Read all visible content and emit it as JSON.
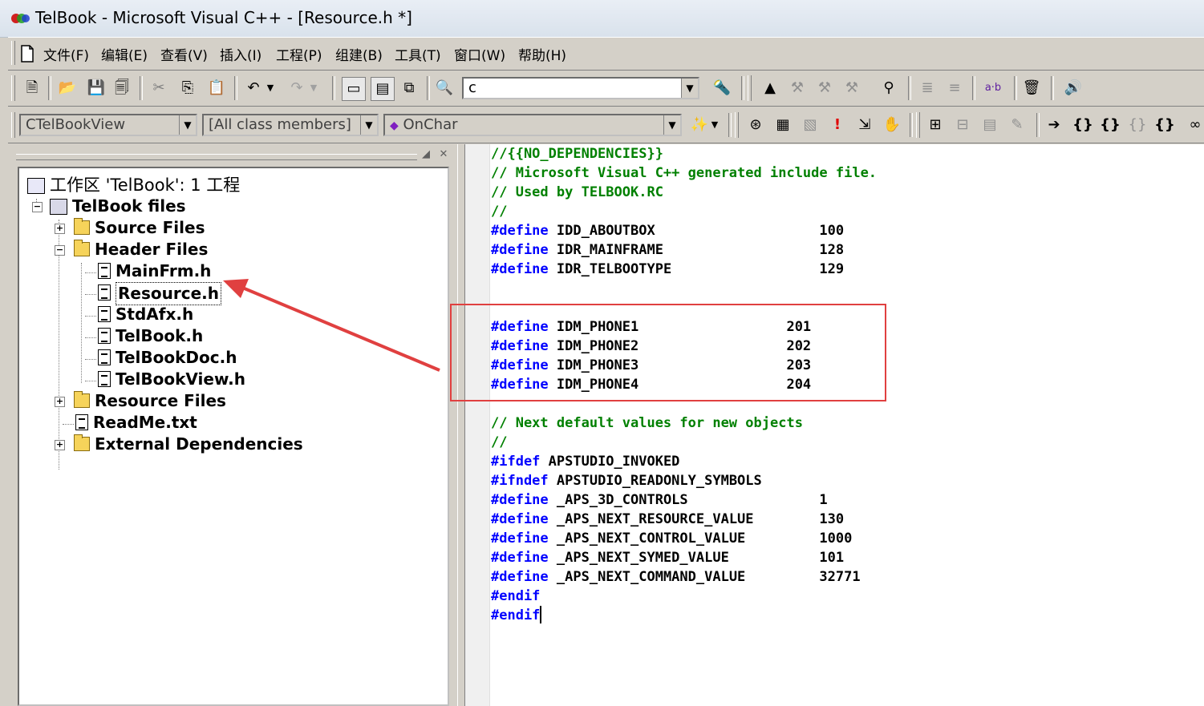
{
  "window": {
    "title": "TelBook - Microsoft Visual C++ - [Resource.h *]"
  },
  "menu": [
    "文件(F)",
    "编辑(E)",
    "查看(V)",
    "插入(I)",
    "工程(P)",
    "组建(B)",
    "工具(T)",
    "窗口(W)",
    "帮助(H)"
  ],
  "toolbar": {
    "find_combo_value": "c",
    "ab_label": "a·b"
  },
  "wizardbar": {
    "class_combo": "CTelBookView",
    "filter_combo": "[All class members]",
    "member_combo": "OnChar"
  },
  "workspace": {
    "root": "工作区 'TelBook': 1 工程",
    "project": "TelBook files",
    "source_files": "Source Files",
    "header_files": "Header Files",
    "headers": [
      "MainFrm.h",
      "Resource.h",
      "StdAfx.h",
      "TelBook.h",
      "TelBookDoc.h",
      "TelBookView.h"
    ],
    "resource_files": "Resource Files",
    "readme": "ReadMe.txt",
    "external": "External Dependencies"
  },
  "code": {
    "l1": "//{{NO_DEPENDENCIES}}",
    "l2": "// Microsoft Visual C++ generated include file.",
    "l3": "// Used by TELBOOK.RC",
    "l4": "//",
    "define": "#define",
    "ifdef": "#ifdef",
    "ifndef": "#ifndef",
    "endif": "#endif",
    "d1": " IDD_ABOUTBOX                    100",
    "d2": " IDR_MAINFRAME                   128",
    "d3": " IDR_TELBOOTYPE                  129",
    "p1": " IDM_PHONE1                  201",
    "p2": " IDM_PHONE2                  202",
    "p3": " IDM_PHONE3                  203",
    "p4": " IDM_PHONE4                  204",
    "c1": "// Next default values for new objects",
    "c2": "//",
    "if1": " APSTUDIO_INVOKED",
    "if2": " APSTUDIO_READONLY_SYMBOLS",
    "a1": " _APS_3D_CONTROLS                1",
    "a2": " _APS_NEXT_RESOURCE_VALUE        130",
    "a3": " _APS_NEXT_CONTROL_VALUE         1000",
    "a4": " _APS_NEXT_SYMED_VALUE           101",
    "a5": " _APS_NEXT_COMMAND_VALUE         32771"
  },
  "colors": {
    "keyword": "#0000ff",
    "comment": "#008000",
    "annotation": "#e04040"
  }
}
